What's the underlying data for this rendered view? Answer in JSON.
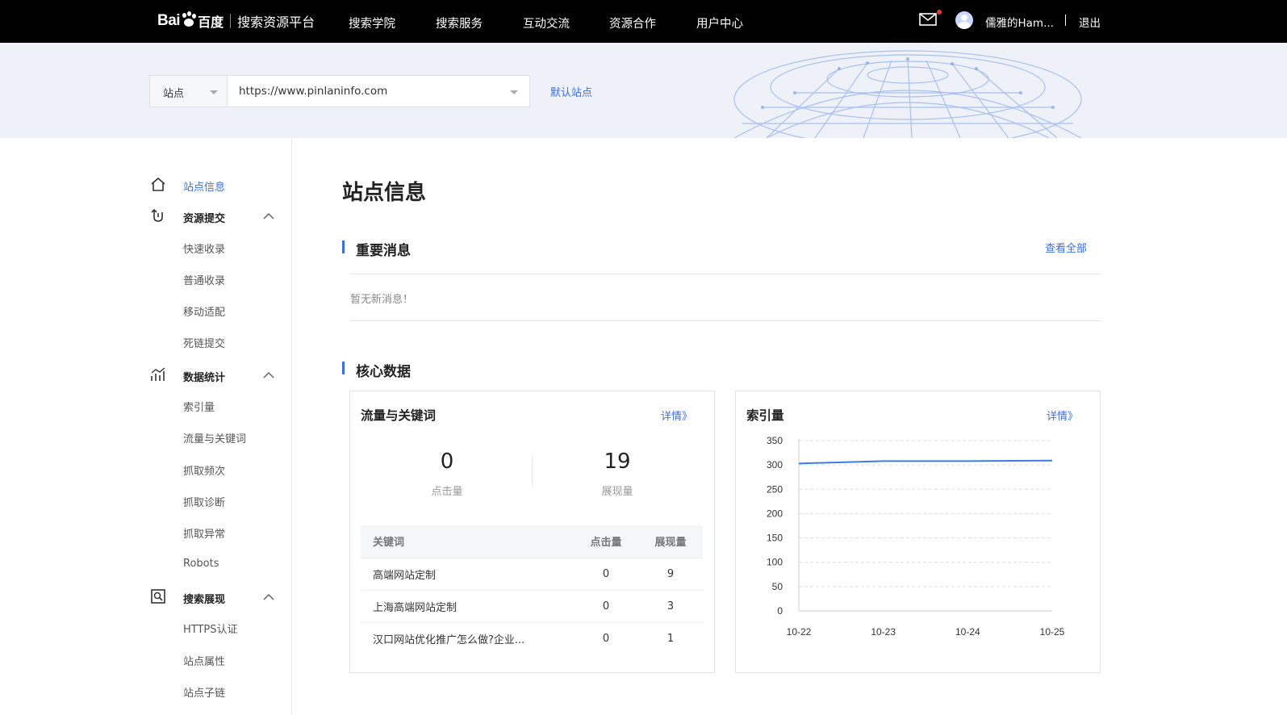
{
  "header": {
    "logo_bai": "Bai",
    "logo_du": "百度",
    "platform_name": "搜索资源平台",
    "nav": [
      "搜索学院",
      "搜索服务",
      "互动交流",
      "资源合作",
      "用户中心"
    ],
    "username": "儒雅的Ham...",
    "separator": "|",
    "logout": "退出",
    "icons": {
      "mail": "mail-icon",
      "avatar": "avatar-icon"
    },
    "notification_dot_color": "#e53935"
  },
  "site_bar": {
    "type_label": "站点",
    "url": "https://www.pinlaninfo.com",
    "default_site": "默认站点"
  },
  "sidebar": {
    "site_info": "站点信息",
    "groups": [
      {
        "label": "资源提交",
        "icon": "submit-icon",
        "items": [
          "快速收录",
          "普通收录",
          "移动适配",
          "死链提交"
        ]
      },
      {
        "label": "数据统计",
        "icon": "stats-icon",
        "items": [
          "索引量",
          "流量与关键词",
          "抓取频次",
          "抓取诊断",
          "抓取异常",
          "Robots"
        ]
      },
      {
        "label": "搜索展现",
        "icon": "search-display-icon",
        "items": [
          "HTTPS认证",
          "站点属性",
          "站点子链"
        ]
      }
    ]
  },
  "main": {
    "title": "站点信息",
    "messages": {
      "title": "重要消息",
      "view_all": "查看全部",
      "empty_text": "暂无新消息！"
    },
    "core": {
      "title": "核心数据",
      "traffic": {
        "title": "流量与关键词",
        "link": "详情》",
        "clicks_value": "0",
        "clicks_label": "点击量",
        "impressions_value": "19",
        "impressions_label": "展现量",
        "table": {
          "headers": [
            "关键词",
            "点击量",
            "展现量"
          ],
          "rows": [
            [
              "高端网站定制",
              "0",
              "9"
            ],
            [
              "上海高端网站定制",
              "0",
              "3"
            ],
            [
              "汉口网站优化推广怎么做?企业...",
              "0",
              "1"
            ]
          ]
        }
      },
      "index": {
        "title": "索引量",
        "link": "详情》"
      }
    }
  },
  "colors": {
    "accent": "#3b6ee8",
    "topbar": "#000000",
    "banner": "#eef1f7"
  },
  "chart_data": {
    "type": "line",
    "categories": [
      "10-22",
      "10-23",
      "10-24",
      "10-25"
    ],
    "series": [
      {
        "values": [
          303,
          308,
          308,
          309
        ]
      }
    ],
    "ylim": [
      0,
      350
    ],
    "yticks": [
      0,
      50,
      100,
      150,
      200,
      250,
      300,
      350
    ],
    "grid": true,
    "line_color": "#3b7de0"
  }
}
